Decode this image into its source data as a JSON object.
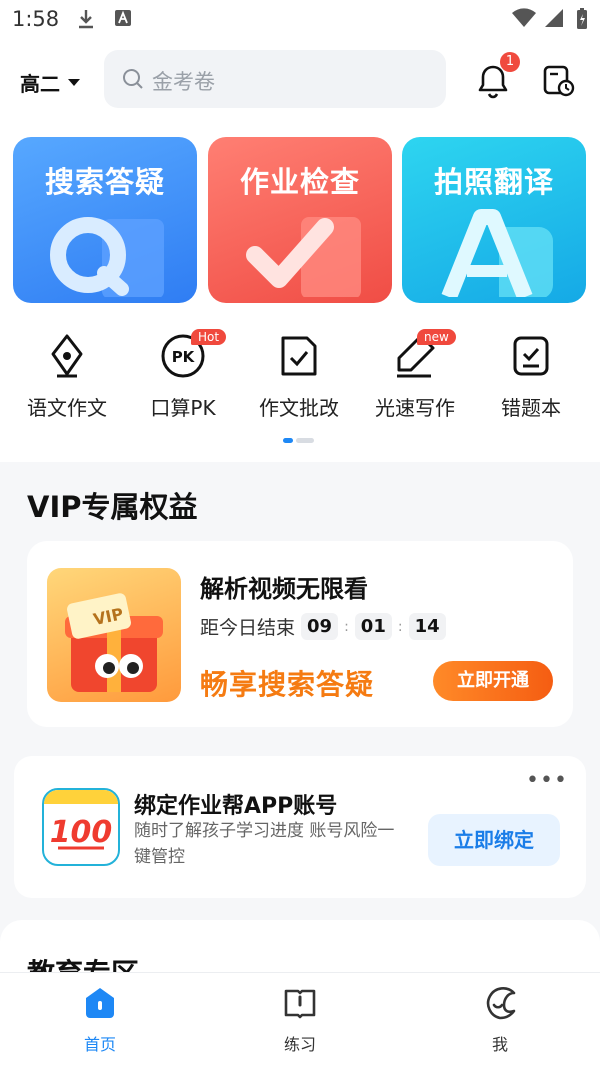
{
  "status_bar": {
    "time": "1:58"
  },
  "header": {
    "grade": "高二",
    "search_placeholder": "金考卷",
    "notification_count": "1"
  },
  "feature_cards": [
    {
      "label": "搜索答疑"
    },
    {
      "label": "作业检查"
    },
    {
      "label": "拍照翻译"
    }
  ],
  "tools": [
    {
      "label": "语文作文",
      "tag": ""
    },
    {
      "label": "口算PK",
      "tag": "Hot"
    },
    {
      "label": "作文批改",
      "tag": ""
    },
    {
      "label": "光速写作",
      "tag": "new"
    },
    {
      "label": "错题本",
      "tag": ""
    }
  ],
  "pager": {
    "page": 1,
    "total": 2
  },
  "vip": {
    "section_title": "VIP专属权益",
    "card_title": "解析视频无限看",
    "countdown_label": "距今日结束",
    "hours": "09",
    "minutes": "01",
    "seconds": "14",
    "promo": "畅享搜索答疑",
    "button": "立即开通",
    "thumb_text": "VIP"
  },
  "bind": {
    "title": "绑定作业帮APP账号",
    "desc": "随时了解孩子学习进度 账号风险一键管控",
    "button": "立即绑定",
    "logo_text": "100"
  },
  "edu": {
    "title": "教育专区"
  },
  "tabbar": [
    {
      "label": "首页",
      "active": true
    },
    {
      "label": "练习",
      "active": false
    },
    {
      "label": "我",
      "active": false
    }
  ],
  "colors": {
    "accent": "#1e88f5",
    "vip_orange": "#f57b12",
    "badge": "#f04a3e"
  }
}
